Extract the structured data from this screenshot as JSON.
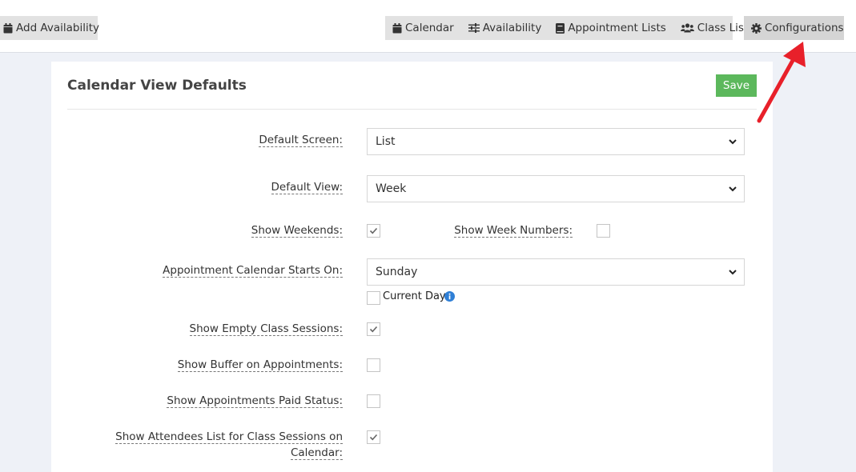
{
  "toolbar": {
    "add_availability": "Add Availability",
    "nav": {
      "calendar": "Calendar",
      "availability": "Availability",
      "appointment_lists": "Appointment Lists",
      "class_lists": "Class Lists"
    },
    "configurations": "Configurations"
  },
  "card": {
    "title": "Calendar View Defaults",
    "save_label": "Save"
  },
  "form": {
    "default_screen": {
      "label": "Default Screen:",
      "value": "List"
    },
    "default_view": {
      "label": "Default View:",
      "value": "Week"
    },
    "show_weekends": {
      "label": "Show Weekends:",
      "checked": true
    },
    "show_week_numbers": {
      "label": "Show Week Numbers:",
      "checked": false
    },
    "calendar_starts_on": {
      "label": "Appointment Calendar Starts On:",
      "value": "Sunday"
    },
    "current_day": {
      "label": "Current Day",
      "checked": false
    },
    "show_empty_class_sessions": {
      "label": "Show Empty Class Sessions:",
      "checked": true
    },
    "show_buffer": {
      "label": "Show Buffer on Appointments:",
      "checked": false
    },
    "show_paid_status": {
      "label": "Show Appointments Paid Status:",
      "checked": false
    },
    "show_attendees": {
      "label_line1": "Show Attendees List for Class Sessions on",
      "label_line2": "Calendar:",
      "checked": true
    }
  },
  "colors": {
    "save_green": "#5cb85c",
    "annotation_arrow": "#e8202a",
    "info_blue": "#2f7fd6"
  }
}
